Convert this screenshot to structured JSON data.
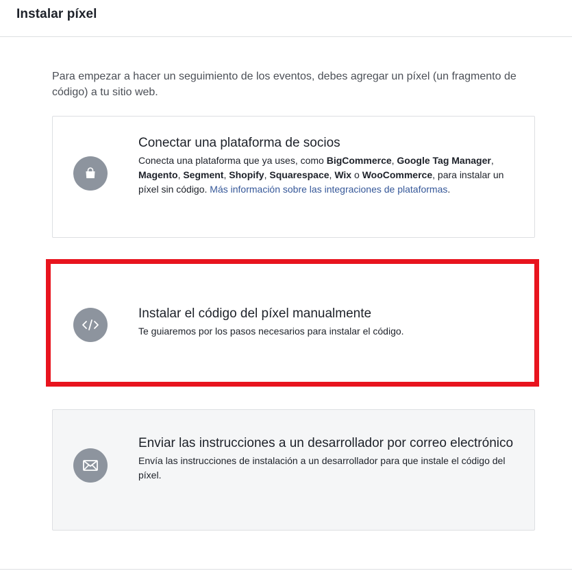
{
  "header": {
    "title": "Instalar píxel"
  },
  "intro": "Para empezar a hacer un seguimiento de los eventos, debes agregar un píxel (un fragmento de código) a tu sitio web.",
  "options": [
    {
      "icon": "shopping-bag-icon",
      "title": "Conectar una plataforma de socios",
      "desc": {
        "t1": "Conecta una plataforma que ya uses, como ",
        "b1": "BigCommerce",
        "t2": ", ",
        "b2": "Google Tag Manager",
        "t3": ", ",
        "b3": "Magento",
        "t4": ", ",
        "b4": "Segment",
        "t5": ", ",
        "b5": "Shopify",
        "t6": ", ",
        "b6": "Squarespace",
        "t7": ", ",
        "b7": "Wix",
        "t8": " o ",
        "b8": "WooCommerce",
        "t9": ", para instalar un píxel sin código. ",
        "link": "Más información sobre las integraciones de plataformas",
        "t10": "."
      }
    },
    {
      "icon": "code-icon",
      "title": "Instalar el código del píxel manualmente",
      "desc": "Te guiaremos por los pasos necesarios para instalar el código.",
      "highlighted": true
    },
    {
      "icon": "envelope-icon",
      "title": "Enviar las instrucciones a un desarrollador por correo electrónico",
      "desc": "Envía las instrucciones de instalación a un desarrollador para que instale el código del píxel."
    }
  ],
  "colors": {
    "highlight_border": "#e8141e",
    "icon_circle": "#8d949e",
    "link": "#365899",
    "card_border": "#dddfe2"
  }
}
